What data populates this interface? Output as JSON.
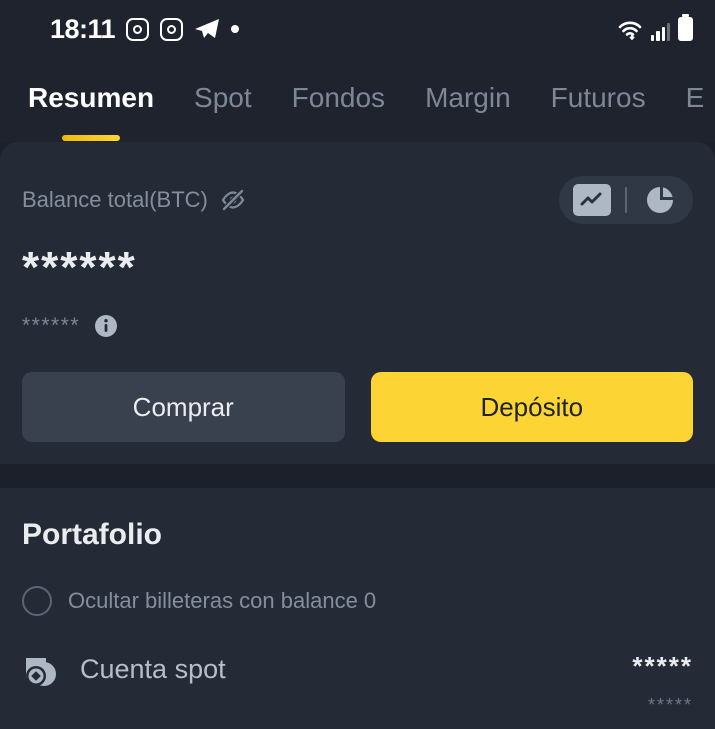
{
  "status_bar": {
    "time": "18:11",
    "left_icons": [
      "instagram-icon",
      "instagram-icon",
      "telegram-icon",
      "dot-indicator"
    ],
    "right_icons": [
      "wifi-icon",
      "cellular-signal-icon",
      "battery-icon"
    ]
  },
  "tabs": [
    {
      "label": "Resumen",
      "active": true
    },
    {
      "label": "Spot",
      "active": false
    },
    {
      "label": "Fondos",
      "active": false
    },
    {
      "label": "Margin",
      "active": false
    },
    {
      "label": "Futuros",
      "active": false
    },
    {
      "label": "E",
      "active": false
    }
  ],
  "balance_card": {
    "label": "Balance total(BTC)",
    "visibility_icon": "eye-off-icon",
    "amount_masked": "******",
    "fiat_masked": "******",
    "info_icon": "info-icon",
    "view_toggle": {
      "chart_icon": "line-chart-icon",
      "pie_icon": "pie-chart-icon",
      "selected": "line-chart-icon"
    },
    "buttons": {
      "buy": "Comprar",
      "deposit": "Depósito"
    }
  },
  "portfolio": {
    "title": "Portafolio",
    "hide_zero_label": "Ocultar billeteras con balance 0",
    "hide_zero_checked": false,
    "wallets": [
      {
        "icon": "spot-account-icon",
        "name": "Cuenta spot",
        "value_masked": "*****",
        "value_sub_masked": "*****"
      }
    ]
  },
  "colors": {
    "page_background": "#1b202a",
    "surface": "#252b36",
    "header_background": "#1e232d",
    "accent_yellow": "#fcd535",
    "accent_yellow_dark": "#f0b90b",
    "text_primary": "#eaecef",
    "text_secondary": "#848e9c",
    "button_secondary": "#3a414e"
  }
}
